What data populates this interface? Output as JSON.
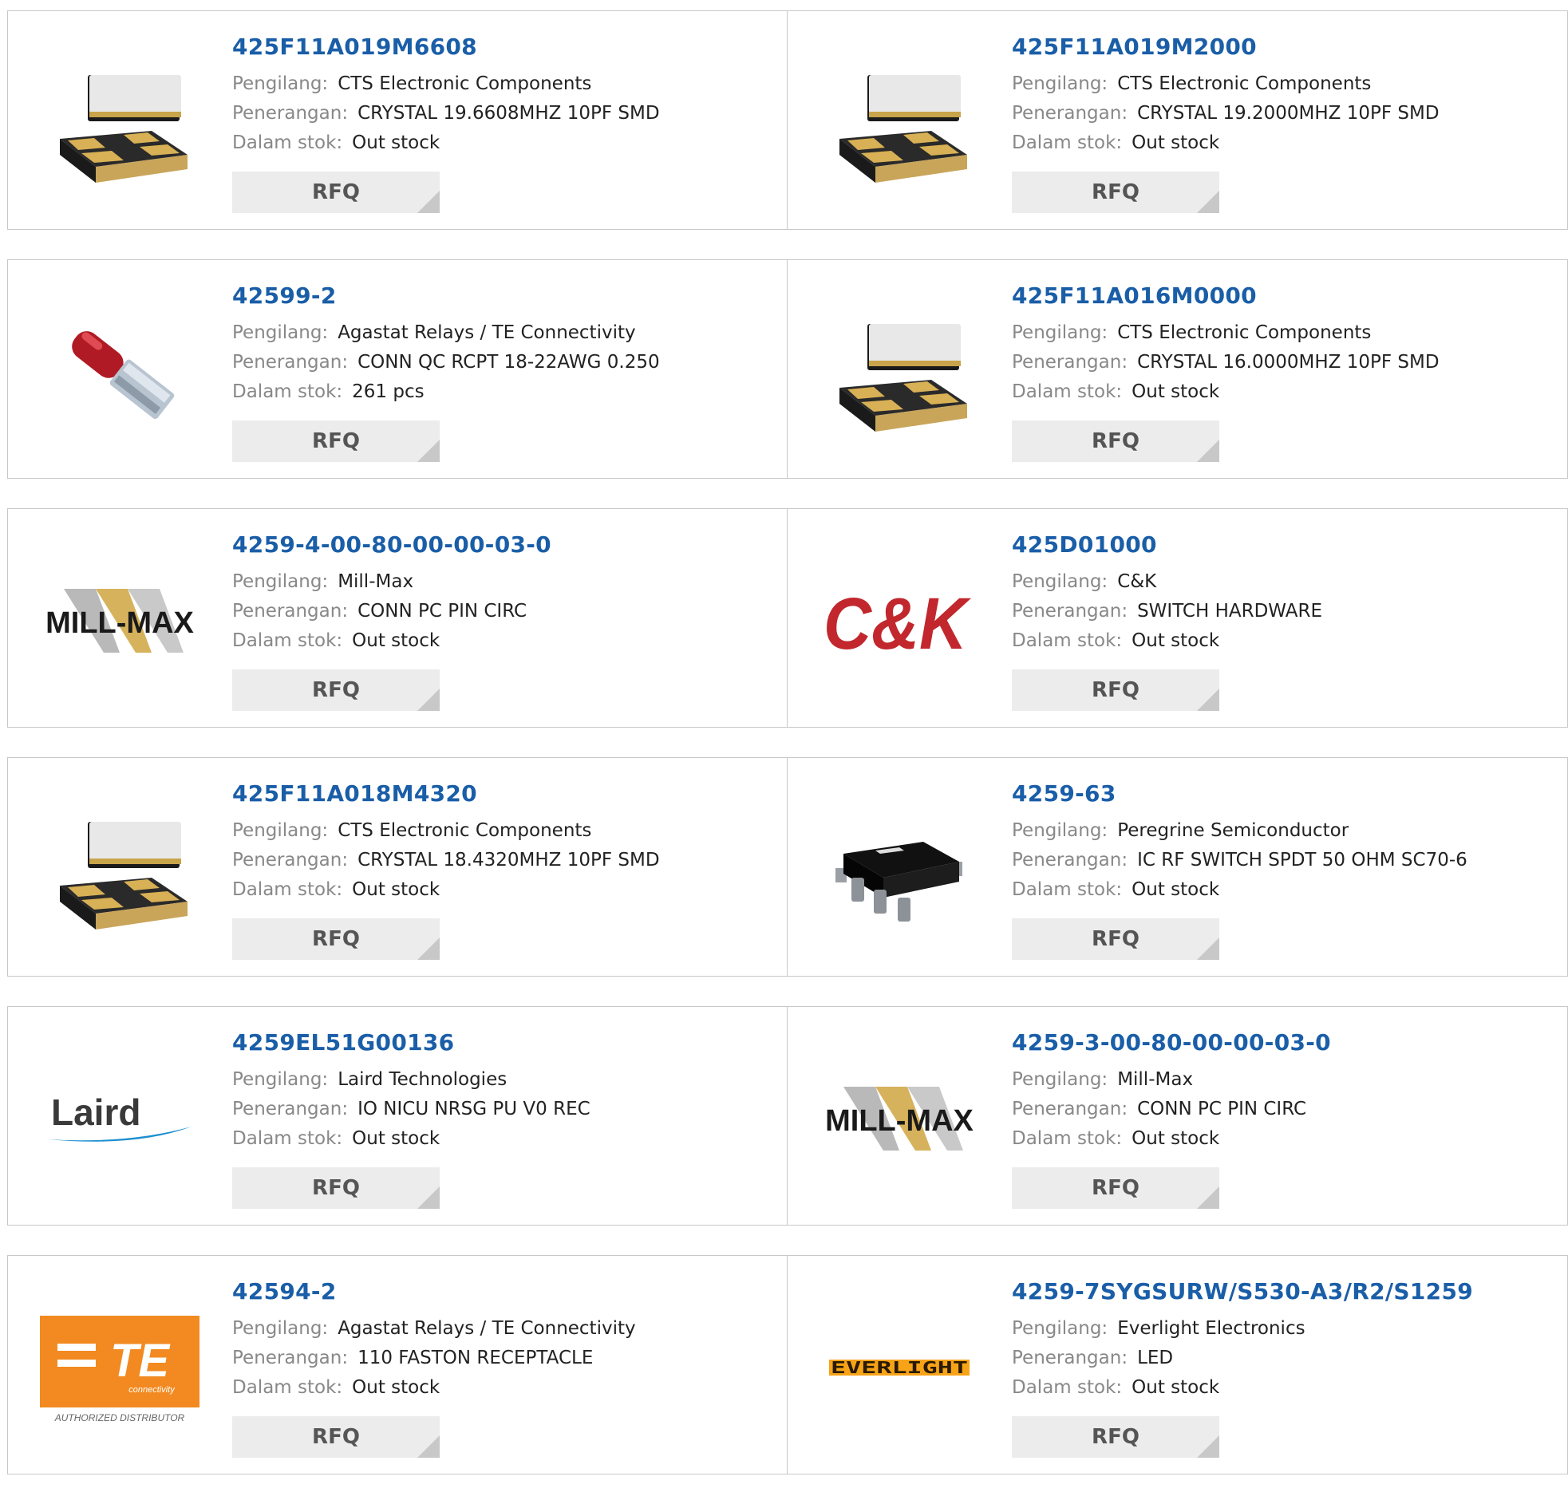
{
  "labels": {
    "manufacturer": "Pengilang:",
    "description": "Penerangan:",
    "stock": "Dalam stok:",
    "rfq": "RFQ"
  },
  "products": [
    {
      "pn": "425F11A019M6608",
      "manufacturer": "CTS Electronic Components",
      "description": "CRYSTAL 19.6608MHZ 10PF SMD",
      "stock": "Out stock",
      "image": "crystal-smd-icon"
    },
    {
      "pn": "425F11A019M2000",
      "manufacturer": "CTS Electronic Components",
      "description": "CRYSTAL 19.2000MHZ 10PF SMD",
      "stock": "Out stock",
      "image": "crystal-smd-icon"
    },
    {
      "pn": "42599-2",
      "manufacturer": "Agastat Relays / TE Connectivity",
      "description": "CONN QC RCPT 18-22AWG 0.250",
      "stock": "261 pcs",
      "image": "faston-connector-icon"
    },
    {
      "pn": "425F11A016M0000",
      "manufacturer": "CTS Electronic Components",
      "description": "CRYSTAL 16.0000MHZ 10PF SMD",
      "stock": "Out stock",
      "image": "crystal-smd-icon"
    },
    {
      "pn": "4259-4-00-80-00-00-03-0",
      "manufacturer": "Mill-Max",
      "description": "CONN PC PIN CIRC",
      "stock": "Out stock",
      "image": "mill-max-logo",
      "logo_text": "MILL-MAX"
    },
    {
      "pn": "425D01000",
      "manufacturer": "C&K",
      "description": "SWITCH HARDWARE",
      "stock": "Out stock",
      "image": "ck-logo",
      "logo_text": "C&K"
    },
    {
      "pn": "425F11A018M4320",
      "manufacturer": "CTS Electronic Components",
      "description": "CRYSTAL 18.4320MHZ 10PF SMD",
      "stock": "Out stock",
      "image": "crystal-smd-icon"
    },
    {
      "pn": "4259-63",
      "manufacturer": "Peregrine Semiconductor",
      "description": "IC RF SWITCH SPDT 50 OHM SC70-6",
      "stock": "Out stock",
      "image": "sc70-chip-icon"
    },
    {
      "pn": "4259EL51G00136",
      "manufacturer": "Laird Technologies",
      "description": "IO NICU NRSG PU V0 REC",
      "stock": "Out stock",
      "image": "laird-logo",
      "logo_text": "Laird"
    },
    {
      "pn": "4259-3-00-80-00-00-03-0",
      "manufacturer": "Mill-Max",
      "description": "CONN PC PIN CIRC",
      "stock": "Out stock",
      "image": "mill-max-logo",
      "logo_text": "MILL-MAX"
    },
    {
      "pn": "42594-2",
      "manufacturer": "Agastat Relays / TE Connectivity",
      "description": "110 FASTON RECEPTACLE",
      "stock": "Out stock",
      "image": "te-logo",
      "logo_text": "TE",
      "logo_sub": "connectivity",
      "logo_caption": "AUTHORIZED DISTRIBUTOR"
    },
    {
      "pn": "4259-7SYGSURW/S530-A3/R2/S1259",
      "manufacturer": "Everlight Electronics",
      "description": "LED",
      "stock": "Out stock",
      "image": "everlight-logo",
      "logo_text": "EVERLIGHT"
    }
  ]
}
